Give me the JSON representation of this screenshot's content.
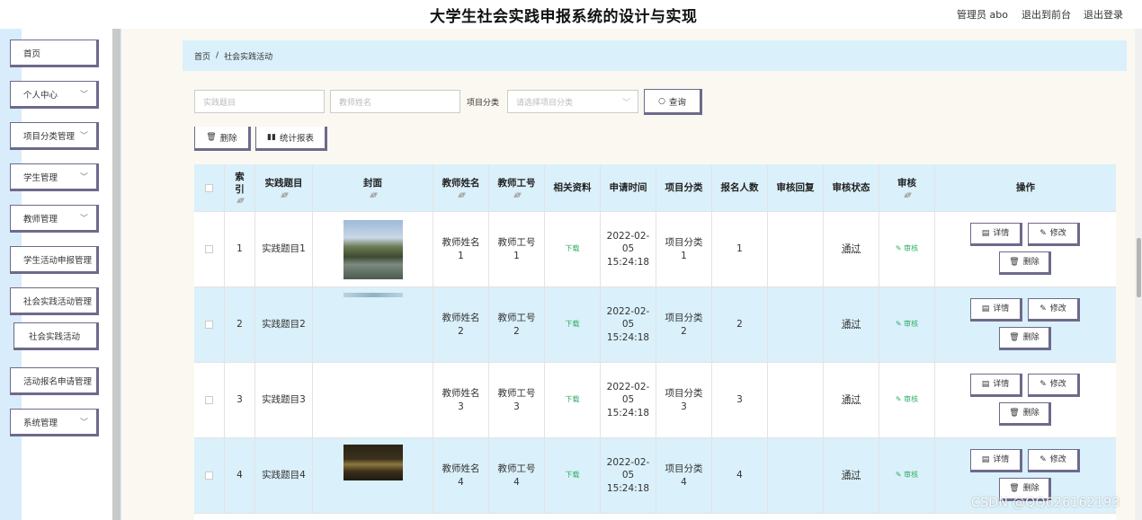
{
  "header": {
    "title": "大学生社会实践申报系统的设计与实现",
    "user": "管理员 abo",
    "back_front": "退出到前台",
    "logout": "退出登录"
  },
  "sidebar": {
    "items": [
      {
        "label": "首页",
        "chevron": false
      },
      {
        "label": "个人中心",
        "chevron": true
      },
      {
        "label": "项目分类管理",
        "chevron": true
      },
      {
        "label": "学生管理",
        "chevron": true
      },
      {
        "label": "教师管理",
        "chevron": true
      },
      {
        "label": "学生活动申报管理",
        "chevron": false
      },
      {
        "label": "社会实践活动管理",
        "chevron": false
      },
      {
        "label": "社会实践活动",
        "chevron": false,
        "sub": true
      },
      {
        "label": "活动报名申请管理",
        "chevron": false
      },
      {
        "label": "系统管理",
        "chevron": true
      }
    ]
  },
  "breadcrumb": {
    "home": "首页",
    "separator": "/",
    "current": "社会实践活动"
  },
  "search": {
    "title_placeholder": "实践题目",
    "teacher_placeholder": "教师姓名",
    "category_label": "项目分类",
    "category_placeholder": "请选择项目分类",
    "query_label": "查询"
  },
  "actions": {
    "delete_label": "删除",
    "report_label": "统计报表"
  },
  "table": {
    "headers": [
      "索引",
      "实践题目",
      "封面",
      "教师姓名",
      "教师工号",
      "相关资料",
      "申请时间",
      "项目分类",
      "报名人数",
      "审核回复",
      "审核状态",
      "审核",
      "操作"
    ],
    "rows": [
      {
        "index": "1",
        "title": "实践题目1",
        "cover": "photo-campus-day",
        "teacher_name": "教师姓名1",
        "teacher_id": "教师工号1",
        "material": "下载",
        "time": "2022-02-05 15:24:18",
        "category": "项目分类1",
        "count": "1",
        "reply": "",
        "status": "通过",
        "review": "审核"
      },
      {
        "index": "2",
        "title": "实践题目2",
        "cover": "photo-strip",
        "teacher_name": "教师姓名2",
        "teacher_id": "教师工号2",
        "material": "下载",
        "time": "2022-02-05 15:24:18",
        "category": "项目分类2",
        "count": "2",
        "reply": "",
        "status": "通过",
        "review": "审核"
      },
      {
        "index": "3",
        "title": "实践题目3",
        "cover": "",
        "teacher_name": "教师姓名3",
        "teacher_id": "教师工号3",
        "material": "下载",
        "time": "2022-02-05 15:24:18",
        "category": "项目分类3",
        "count": "3",
        "reply": "",
        "status": "通过",
        "review": "审核"
      },
      {
        "index": "4",
        "title": "实践题目4",
        "cover": "photo-campus-night",
        "teacher_name": "教师姓名4",
        "teacher_id": "教师工号4",
        "material": "下载",
        "time": "2022-02-05 15:24:18",
        "category": "项目分类4",
        "count": "4",
        "reply": "",
        "status": "通过",
        "review": "审核"
      }
    ],
    "op_labels": {
      "detail": "详情",
      "edit": "修改",
      "delete": "删除"
    }
  },
  "watermark": "CSDN @QQ626162193",
  "colors": {
    "accent_light_blue": "#daf0fb",
    "button_border": "#6d6a8c",
    "link_green": "#2fae62",
    "sidebar_bg": "#d9ecfb"
  }
}
